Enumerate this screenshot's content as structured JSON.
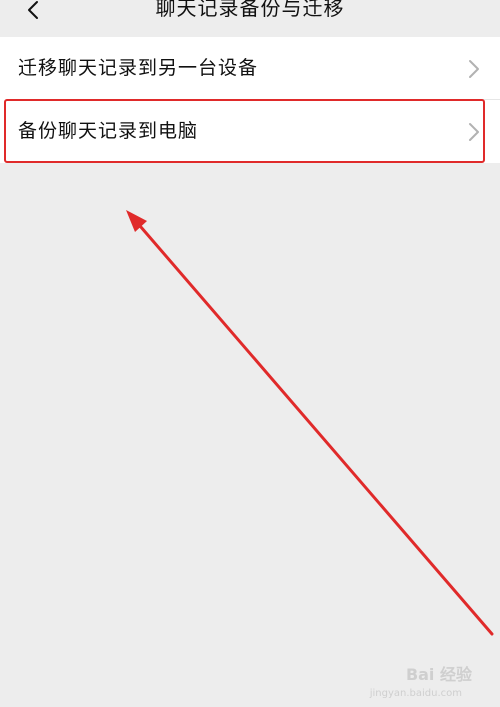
{
  "navbar": {
    "title": "聊天记录备份与迁移",
    "back_icon": "chevron-left-icon"
  },
  "list": {
    "items": [
      {
        "label": "迁移聊天记录到另一台设备",
        "icon": "chevron-right-icon"
      },
      {
        "label": "备份聊天记录到电脑",
        "icon": "chevron-right-icon"
      }
    ]
  },
  "annotation": {
    "highlight_color": "#e02a2a",
    "arrow_color": "#e02a2a"
  },
  "watermark": {
    "text": "Bai 经验",
    "sub": "jingyan.baidu.com"
  },
  "colors": {
    "background": "#ededed",
    "cell_background": "#ffffff",
    "text": "#111111",
    "chevron": "#b2b2b2"
  }
}
